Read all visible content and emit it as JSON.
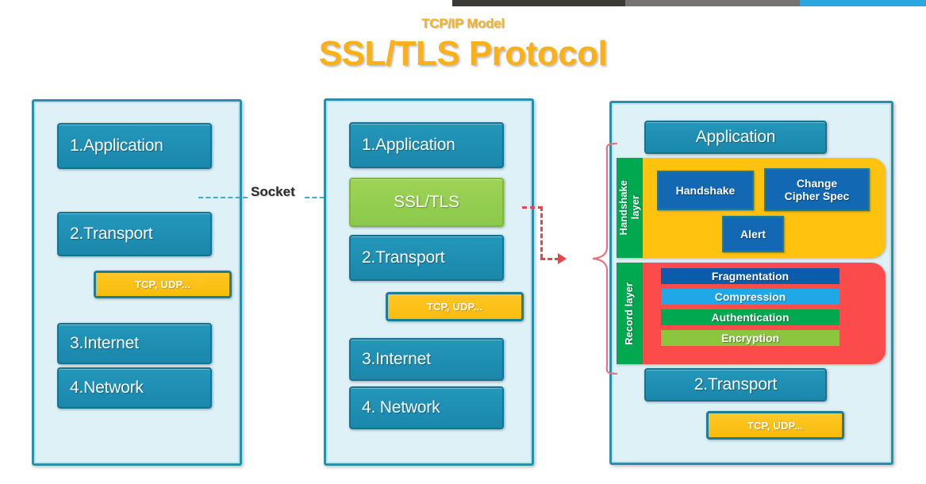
{
  "topbar": {
    "segments": [
      {
        "name": "dark",
        "color": "#3c3a37"
      },
      {
        "name": "gray",
        "color": "#767372"
      },
      {
        "name": "blue",
        "color": "#29a8e0"
      }
    ]
  },
  "header": {
    "subtitle": "TCP/IP Model",
    "title": "SSL/TLS Protocol",
    "subtitle_color": "#f0b429",
    "title_color": "#fbb016"
  },
  "connector": {
    "socket_label": "Socket",
    "socket_line_color": "#4aa8c4",
    "red_arrow_color": "#e8444c",
    "brace_color": "#e8737f"
  },
  "panels": {
    "left": {
      "name": "tcp-ip-stack",
      "layers": [
        {
          "label": "1.Application"
        },
        {
          "label": "2.Transport"
        },
        {
          "label": "3.Internet"
        },
        {
          "label": "4.Network"
        }
      ],
      "protocols": "TCP, UDP..."
    },
    "middle": {
      "name": "tcp-ip-stack-with-ssl",
      "layers": [
        {
          "label": "1.Application"
        },
        {
          "label": "SSL/TLS",
          "highlight": true
        },
        {
          "label": "2.Transport"
        },
        {
          "label": "3.Internet"
        },
        {
          "label": "4. Network"
        }
      ],
      "protocols": "TCP, UDP..."
    },
    "right": {
      "name": "ssl-tls-detail",
      "application_label": "Application",
      "handshake_layer": {
        "vertical_label_line1": "Handshake",
        "vertical_label_line2": "layer",
        "container_color": "#ffc20e",
        "label_color": "#00a84f",
        "components": [
          {
            "label": "Handshake"
          },
          {
            "label": "Change\nCipher Spec"
          },
          {
            "label": "Alert"
          }
        ]
      },
      "record_layer": {
        "vertical_label": "Record layer",
        "container_color": "#fb4b4b",
        "label_color": "#00a84f",
        "components": [
          {
            "label": "Fragmentation",
            "color": "#0b5cab"
          },
          {
            "label": "Compression",
            "color": "#1fa7e8"
          },
          {
            "label": "Authentication",
            "color": "#00a94f"
          },
          {
            "label": "Encryption",
            "color": "#8cc63e"
          }
        ]
      },
      "transport_label": "2.Transport",
      "protocols": "TCP, UDP..."
    }
  }
}
